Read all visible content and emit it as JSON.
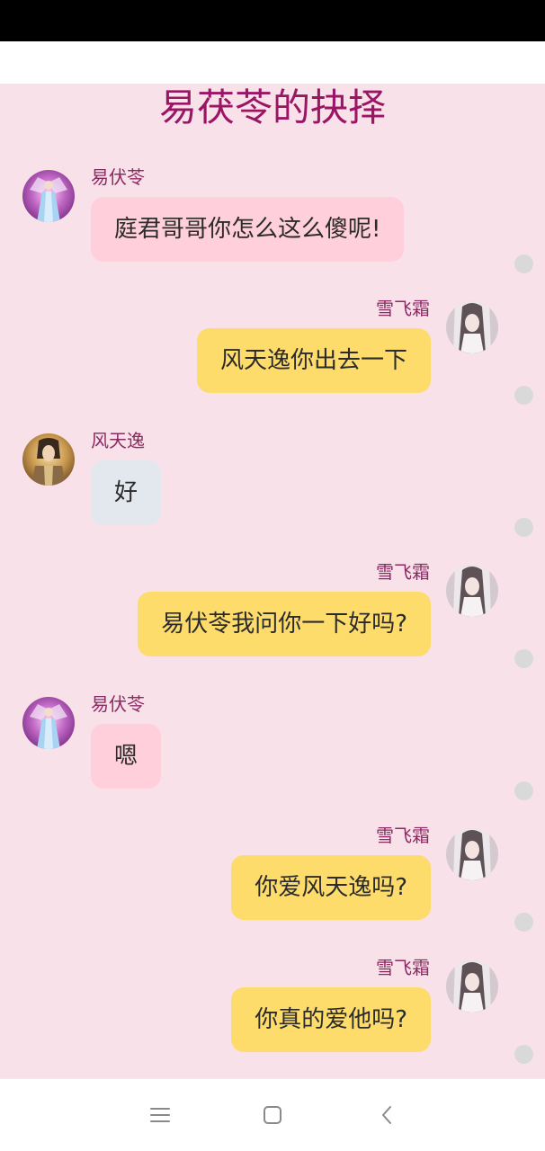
{
  "title": "易茯苓的抉择",
  "colors": {
    "title": "#9b1565",
    "background": "#f9e1ea",
    "bubble_yellow": "#fddc6c",
    "bubble_pink": "#ffcfdb",
    "bubble_gray": "#e3e8ef",
    "name": "#8b2a62"
  },
  "messages": [
    {
      "side": "left",
      "name": "易伏苓",
      "text": "庭君哥哥你怎么这么傻呢!",
      "bubble": "pink",
      "avatar": "avatar-yi-fuling"
    },
    {
      "side": "right",
      "name": "雪飞霜",
      "text": "风天逸你出去一下",
      "bubble": "yellow",
      "avatar": "avatar-xue-feishuang"
    },
    {
      "side": "left",
      "name": "风天逸",
      "text": "好",
      "bubble": "gray",
      "avatar": "avatar-feng-tianyi"
    },
    {
      "side": "right",
      "name": "雪飞霜",
      "text": "易伏苓我问你一下好吗?",
      "bubble": "yellow",
      "avatar": "avatar-xue-feishuang"
    },
    {
      "side": "left",
      "name": "易伏苓",
      "text": "嗯",
      "bubble": "pink",
      "avatar": "avatar-yi-fuling"
    },
    {
      "side": "right",
      "name": "雪飞霜",
      "text": "你爱风天逸吗?",
      "bubble": "yellow",
      "avatar": "avatar-xue-feishuang"
    },
    {
      "side": "right",
      "name": "雪飞霜",
      "text": "你真的爱他吗?",
      "bubble": "yellow",
      "avatar": "avatar-xue-feishuang"
    }
  ],
  "nav": {
    "menu_icon": "menu-icon",
    "home_icon": "home-square-icon",
    "back_icon": "back-chevron-icon"
  }
}
